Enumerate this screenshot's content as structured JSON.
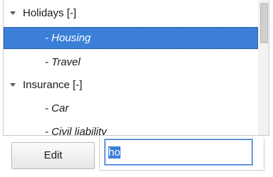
{
  "tree": {
    "rows": [
      {
        "type": "group",
        "label": "Holidays [-]",
        "expanded": true,
        "selected": false
      },
      {
        "type": "child",
        "label": "- Housing",
        "selected": true
      },
      {
        "type": "child",
        "label": "- Travel",
        "selected": false
      },
      {
        "type": "group",
        "label": "Insurance [-]",
        "expanded": true,
        "selected": false
      },
      {
        "type": "child",
        "label": "- Car",
        "selected": false
      },
      {
        "type": "child",
        "label": "- Civil liability",
        "selected": false
      }
    ]
  },
  "actions": {
    "edit_label": "Edit"
  },
  "rename": {
    "value": "ho"
  },
  "colors": {
    "selection": "#3b7fd8",
    "input_focus_border": "#3d7ad6"
  }
}
